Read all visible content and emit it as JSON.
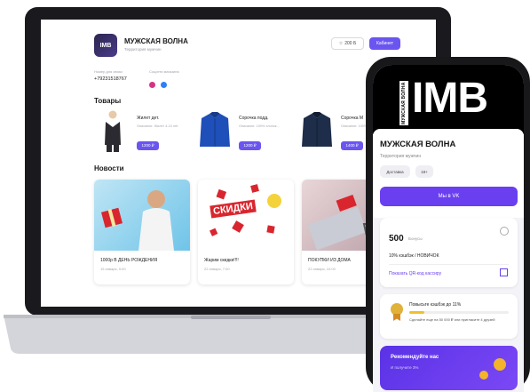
{
  "laptop": {
    "shop": {
      "logo_text": "IMB",
      "name": "МУЖСКАЯ ВОЛНА",
      "subtitle": "Территория мужчин"
    },
    "header": {
      "fav_label": "200 Б",
      "login_label": "Кабинет"
    },
    "info": {
      "phone_label": "Номер для связи",
      "phone_value": "+79231518767",
      "social_label": "Соцсети магазина"
    },
    "products_title": "Товары",
    "products": [
      {
        "name": "Жилет дет.",
        "desc": "Описание. Жилет 4-10 лет",
        "price": "1200 ₽"
      },
      {
        "name": "Сорочка подд.",
        "desc": "Описание. 100% хлопок...",
        "price": "1200 ₽"
      },
      {
        "name": "Сорочка М",
        "desc": "Описание. 100%",
        "price": "1400 ₽"
      }
    ],
    "news_title": "Новости",
    "news": [
      {
        "title": "1000р В ДЕНЬ РОЖДЕНИЯ",
        "date": "15 января, 9:00"
      },
      {
        "title": "Жарим скидки!!!!",
        "date": "22 января, 7:00"
      },
      {
        "title": "ПОКУПКИ ИЗ ДОМА",
        "date": "22 января, 10:00"
      }
    ],
    "sale_text": "СКИДКИ"
  },
  "phone": {
    "logo_side": "МУЖСКАЯ ВОЛНА",
    "logo_big": "IMB",
    "title": "МУЖСКАЯ ВОЛНА",
    "subtitle": "Территория мужчин",
    "tags": [
      "Доставка",
      "18+"
    ],
    "vk_button": "Мы в VK",
    "bonus_value": "500",
    "bonus_unit": "Бонусы",
    "cashback": "10% кэшбэк / НОВИЧОК",
    "qr_label": "Показать QR-код кассиру",
    "level_title": "Повысьте кэшбэк до 11%",
    "level_desc": "Сделайте еще на 50 000 ₽ или пригласите 4 друзей",
    "level_progress": 0.15,
    "recommend_title": "Рекомендуйте нас",
    "recommend_sub": "И получите 3%"
  },
  "colors": {
    "accent": "#6a55f0",
    "vk_purple": "#6a3ff0",
    "gold": "#f0c02a"
  }
}
